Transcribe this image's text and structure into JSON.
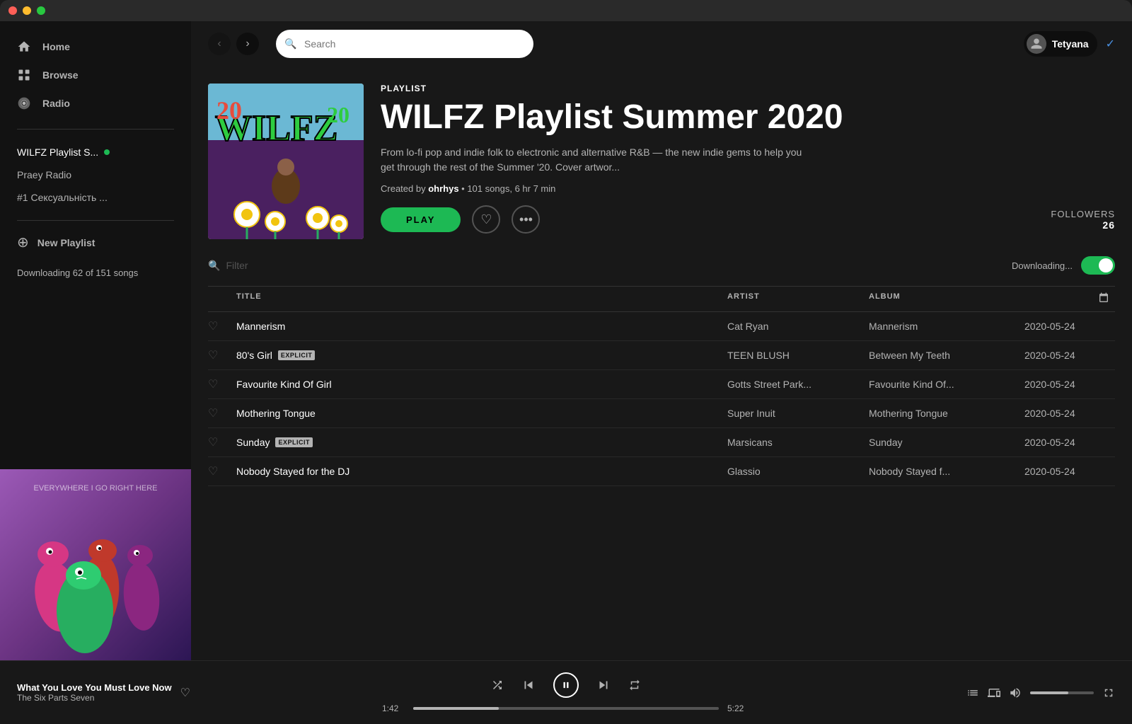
{
  "titleBar": {
    "trafficLights": [
      "red",
      "yellow",
      "green"
    ]
  },
  "sidebar": {
    "navItems": [
      {
        "id": "home",
        "label": "Home",
        "icon": "home"
      },
      {
        "id": "browse",
        "label": "Browse",
        "icon": "browse"
      },
      {
        "id": "radio",
        "label": "Radio",
        "icon": "radio"
      }
    ],
    "playlists": [
      {
        "id": "wilfz",
        "label": "WILFZ Playlist S...",
        "active": true,
        "dot": true
      },
      {
        "id": "praey",
        "label": "Praey Radio",
        "active": false
      },
      {
        "id": "sexy",
        "label": "#1 Сексуальність ...",
        "active": false
      }
    ],
    "newPlaylist": "New Playlist",
    "downloadStatus": "Downloading 62 of 151 songs"
  },
  "topBar": {
    "searchPlaceholder": "Search",
    "userName": "Tetyana"
  },
  "playlist": {
    "type": "PLAYLIST",
    "title": "WILFZ Playlist Summer 2020",
    "description": "From lo-fi pop and indie folk to electronic and alternative R&B — the new indie gems to help you get through the rest of the Summer '20. Cover artwor...",
    "creator": "ohrhys",
    "songCount": "101 songs",
    "duration": "6 hr 7 min",
    "followers": "FOLLOWERS",
    "followersCount": "26",
    "playLabel": "PLAY",
    "downloadingLabel": "Downloading...",
    "filterPlaceholder": "Filter"
  },
  "trackTable": {
    "headers": {
      "like": "",
      "title": "TITLE",
      "artist": "ARTIST",
      "album": "ALBUM",
      "date": ""
    },
    "tracks": [
      {
        "id": 1,
        "title": "Mannerism",
        "explicit": false,
        "artist": "Cat Ryan",
        "album": "Mannerism",
        "date": "2020-05-24"
      },
      {
        "id": 2,
        "title": "80's Girl",
        "explicit": true,
        "artist": "TEEN BLUSH",
        "album": "Between My Teeth",
        "date": "2020-05-24"
      },
      {
        "id": 3,
        "title": "Favourite Kind Of Girl",
        "explicit": false,
        "artist": "Gotts Street Park...",
        "album": "Favourite Kind Of...",
        "date": "2020-05-24"
      },
      {
        "id": 4,
        "title": "Mothering Tongue",
        "explicit": false,
        "artist": "Super Inuit",
        "album": "Mothering Tongue",
        "date": "2020-05-24"
      },
      {
        "id": 5,
        "title": "Sunday",
        "explicit": true,
        "artist": "Marsicans",
        "album": "Sunday",
        "date": "2020-05-24"
      },
      {
        "id": 6,
        "title": "Nobody Stayed for the DJ",
        "explicit": false,
        "artist": "Glassio",
        "album": "Nobody Stayed f...",
        "date": "2020-05-24"
      }
    ],
    "explicitLabel": "EXPLICIT"
  },
  "player": {
    "trackTitle": "What You Love You Must Love Now",
    "trackArtist": "The Six Parts Seven",
    "currentTime": "1:42",
    "totalTime": "5:22",
    "progressPercent": 28
  }
}
